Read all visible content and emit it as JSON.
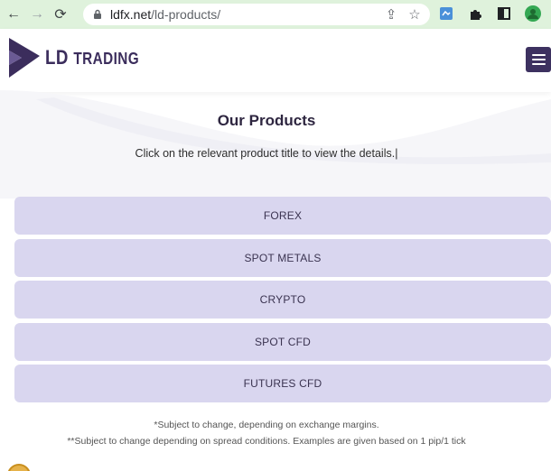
{
  "browser": {
    "url_host": "ldfx.net",
    "url_path": "/ld-products/",
    "icons": [
      "back-icon",
      "forward-icon",
      "reload-icon",
      "lock-icon",
      "share-icon",
      "star-icon",
      "extension-icon",
      "puzzle-icon",
      "sidebar-icon",
      "profile-icon",
      "menu-icon"
    ]
  },
  "header": {
    "logo_ld": "LD",
    "logo_trading": "Trading",
    "menu_icon": "hamburger-icon"
  },
  "main": {
    "title": "Our Products",
    "subtitle": "Click on the relevant product title to view the details.|",
    "products": [
      {
        "label": "FOREX"
      },
      {
        "label": "SPOT METALS"
      },
      {
        "label": "CRYPTO"
      },
      {
        "label": "SPOT CFD"
      },
      {
        "label": "FUTURES CFD"
      }
    ],
    "note1": "*Subject to change, depending on exchange margins.",
    "note2": "**Subject to change depending on spread conditions. Examples are given based on 1 pip/1 tick"
  },
  "colors": {
    "chrome_bg": "#dff2dc",
    "brand": "#3b2d5c",
    "product_bg": "#d9d6ef"
  }
}
